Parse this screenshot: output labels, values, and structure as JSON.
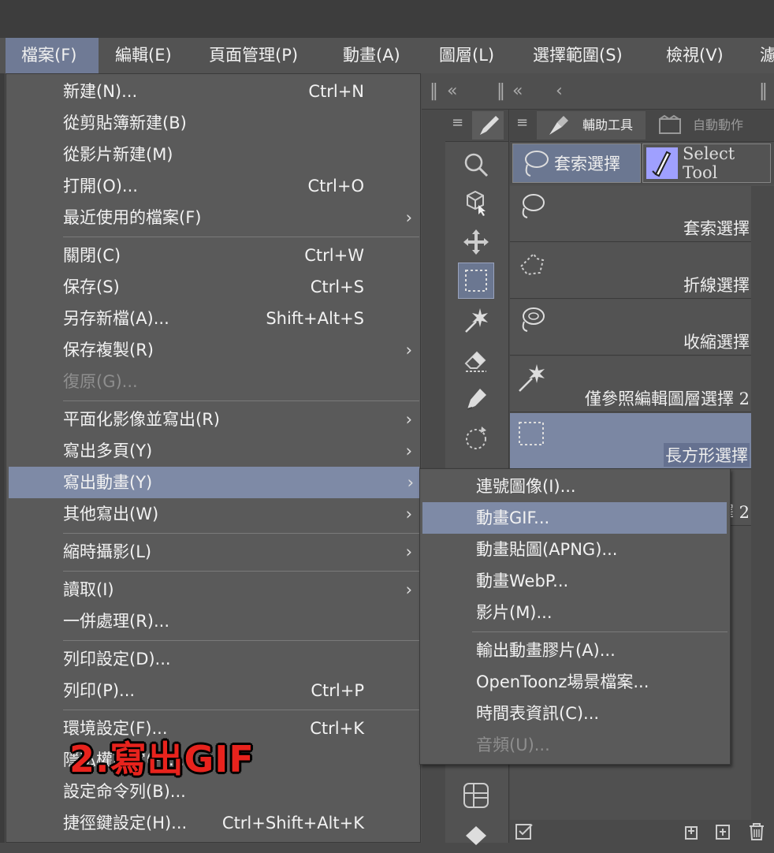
{
  "menubar": {
    "items": [
      {
        "label": "檔案(F)"
      },
      {
        "label": "編輯(E)"
      },
      {
        "label": "頁面管理(P)"
      },
      {
        "label": "動畫(A)"
      },
      {
        "label": "圖層(L)"
      },
      {
        "label": "選擇範圍(S)"
      },
      {
        "label": "檢視(V)"
      },
      {
        "label": "濾"
      }
    ]
  },
  "file_menu": {
    "items": [
      {
        "label": "新建(N)...",
        "shortcut": "Ctrl+N"
      },
      {
        "label": "從剪貼簿新建(B)",
        "shortcut": ""
      },
      {
        "label": "從影片新建(M)",
        "shortcut": ""
      },
      {
        "label": "打開(O)...",
        "shortcut": "Ctrl+O"
      },
      {
        "label": "最近使用的檔案(F)",
        "shortcut": ""
      },
      {
        "label": "關閉(C)",
        "shortcut": "Ctrl+W"
      },
      {
        "label": "保存(S)",
        "shortcut": "Ctrl+S"
      },
      {
        "label": "另存新檔(A)...",
        "shortcut": "Shift+Alt+S"
      },
      {
        "label": "保存複製(R)",
        "shortcut": ""
      },
      {
        "label": "復原(G)...",
        "shortcut": ""
      },
      {
        "label": "平面化影像並寫出(R)",
        "shortcut": ""
      },
      {
        "label": "寫出多頁(Y)",
        "shortcut": ""
      },
      {
        "label": "寫出動畫(Y)",
        "shortcut": ""
      },
      {
        "label": "其他寫出(W)",
        "shortcut": ""
      },
      {
        "label": "縮時攝影(L)",
        "shortcut": ""
      },
      {
        "label": "讀取(I)",
        "shortcut": ""
      },
      {
        "label": "一併處理(R)...",
        "shortcut": ""
      },
      {
        "label": "列印設定(D)...",
        "shortcut": ""
      },
      {
        "label": "列印(P)...",
        "shortcut": "Ctrl+P"
      },
      {
        "label": "環境設定(F)...",
        "shortcut": "Ctrl+K"
      },
      {
        "label": "隱私權設定(P)...",
        "shortcut": ""
      },
      {
        "label": "設定命令列(B)...",
        "shortcut": ""
      },
      {
        "label": "捷徑鍵設定(H)...",
        "shortcut": "Ctrl+Shift+Alt+K"
      }
    ]
  },
  "export_animation_submenu": {
    "items": [
      {
        "label": "連號圖像(I)..."
      },
      {
        "label": "動畫GIF..."
      },
      {
        "label": "動畫貼圖(APNG)..."
      },
      {
        "label": "動畫WebP..."
      },
      {
        "label": "影片(M)..."
      },
      {
        "label": "輸出動畫膠片(A)..."
      },
      {
        "label": "OpenToonz場景檔案..."
      },
      {
        "label": "時間表資訊(C)..."
      },
      {
        "label": "音頻(U)..."
      }
    ]
  },
  "side_panel": {
    "tabs": [
      {
        "label": "輔助工具"
      },
      {
        "label": "自動動作"
      }
    ],
    "tool_groups": [
      {
        "label": "套索選擇"
      },
      {
        "label": "Select Tool"
      }
    ],
    "subtools": [
      {
        "label": "套索選擇"
      },
      {
        "label": "折線選擇"
      },
      {
        "label": "收縮選擇"
      },
      {
        "label": "僅參照編輯圖層選擇 2"
      },
      {
        "label": "長方形選擇"
      },
      {
        "label": "擇 2"
      }
    ]
  },
  "annotation": {
    "text": "2.寫出GIF",
    "color": "#e8231d"
  },
  "colors": {
    "menu_bg": "#5a5a5a",
    "highlight": "#7e8aa6",
    "menubar_active": "#6f7a95"
  }
}
